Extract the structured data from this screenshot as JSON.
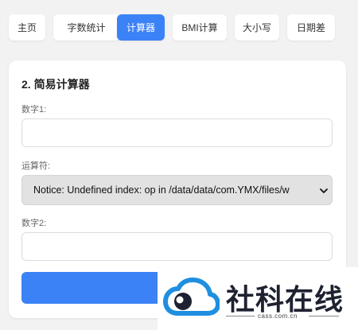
{
  "nav": {
    "tabs": [
      {
        "label": "主页"
      },
      {
        "label": "字数统计"
      },
      {
        "label": "计算器",
        "active": true
      },
      {
        "label": "BMI计算"
      },
      {
        "label": "大小写"
      },
      {
        "label": "日期差"
      }
    ]
  },
  "calculator": {
    "title": "2. 简易计算器",
    "num1_label": "数字1:",
    "num1_value": "",
    "operator_label": "运算符:",
    "operator_value": "Notice: Undefined index: op in /data/data/com.YMX/files/w",
    "num2_label": "数字2:",
    "num2_value": "",
    "button_label": ""
  },
  "watermark": {
    "text": "社科在线",
    "url": "cass.com.cn"
  },
  "colors": {
    "accent": "#3b82f6",
    "page_bg": "#f2f2f2",
    "select_bg": "#e2e2e2",
    "logo_blue": "#1f8fe0"
  },
  "icons": {
    "select_arrow": "chevron-down-icon",
    "logo": "cloud-logo-icon"
  }
}
